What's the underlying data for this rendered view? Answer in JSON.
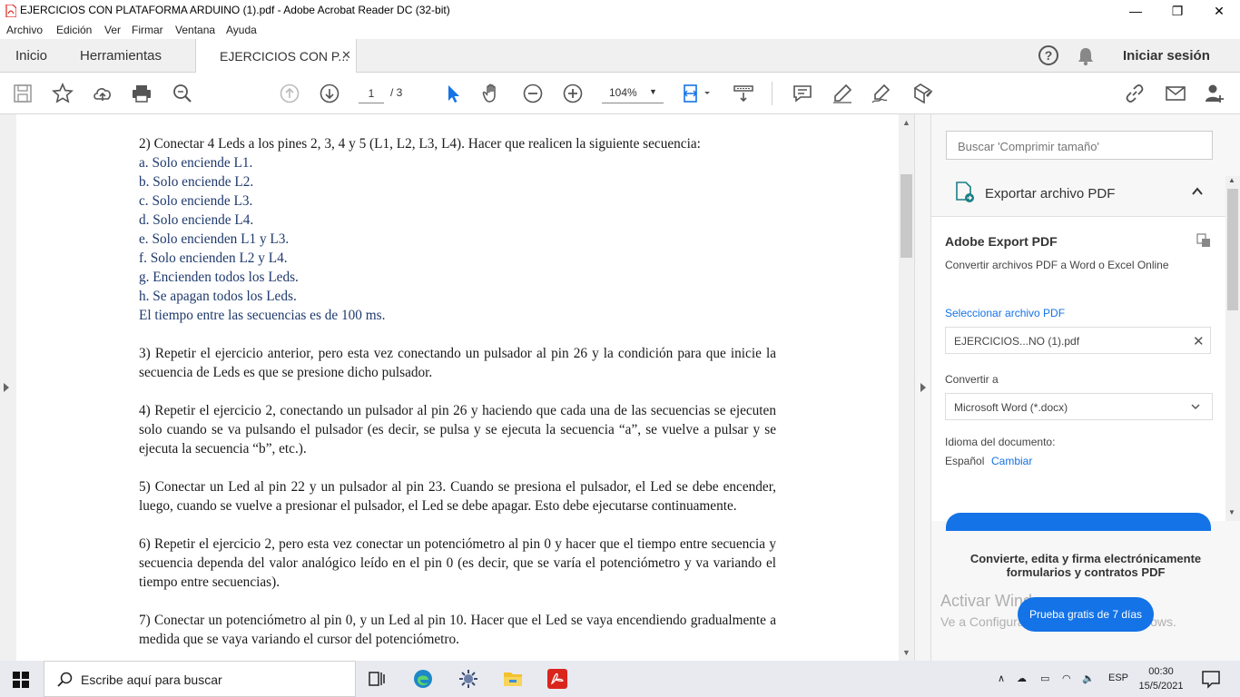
{
  "window": {
    "title": "EJERCICIOS CON PLATAFORMA ARDUINO (1).pdf - Adobe Acrobat Reader DC (32-bit)",
    "minimize": "—",
    "maximize": "❐",
    "close": "✕"
  },
  "menu": [
    "Archivo",
    "Edición",
    "Ver",
    "Firmar",
    "Ventana",
    "Ayuda"
  ],
  "tabs": {
    "home": "Inicio",
    "tools": "Herramientas",
    "document": "EJERCICIOS CON P...",
    "close": "✕"
  },
  "header": {
    "help": "?",
    "signin": "Iniciar sesión"
  },
  "toolbar": {
    "page_current": "1",
    "page_total": "/ 3",
    "zoom": "104%",
    "zoom_caret": "▼"
  },
  "document": {
    "ex2_title": "2) Conectar 4 Leds a los pines 2, 3, 4 y 5 (L1, L2, L3, L4). Hacer que realicen la siguiente secuencia:",
    "ex2_items": [
      "a. Solo enciende L1.",
      "b. Solo enciende L2.",
      "c. Solo enciende L3.",
      "d. Solo enciende L4.",
      "e. Solo encienden L1 y L3.",
      "f. Solo encienden L2 y L4.",
      "g. Encienden todos los Leds.",
      "h. Se apagan todos los Leds.",
      "El tiempo entre las secuencias es de 100 ms."
    ],
    "ex3": "3) Repetir el ejercicio anterior, pero esta vez conectando un pulsador al pin 26 y la condición para que inicie la secuencia de Leds es que se presione dicho pulsador.",
    "ex4": "4) Repetir el ejercicio 2, conectando un pulsador al pin 26 y haciendo que cada una de las secuencias se ejecuten solo cuando se va pulsando el pulsador (es decir, se pulsa y se ejecuta la secuencia “a”, se vuelve a pulsar y se ejecuta la secuencia “b”, etc.).",
    "ex5": "5) Conectar un Led al pin 22 y un pulsador al pin 23. Cuando se presiona el pulsador, el Led se debe encender, luego, cuando se vuelve a presionar el pulsador, el Led se debe apagar. Esto debe ejecutarse continuamente.",
    "ex6": "6) Repetir el ejercicio 2, pero esta vez conectar un potenciómetro al pin 0 y hacer que el tiempo entre secuencia y secuencia dependa del valor analógico leído en el pin 0 (es decir, que se varía el potenciómetro y va variando el tiempo entre secuencias).",
    "ex7": "7) Conectar un potenciómetro al pin 0, y un Led al pin 10. Hacer que el Led se vaya encendiendo gradualmente a medida que se vaya variando el cursor del potenciómetro."
  },
  "right_pane": {
    "search_placeholder": "Buscar 'Comprimir tamaño'",
    "export_title": "Exportar archivo PDF",
    "card_title": "Adobe Export PDF",
    "card_subtitle": "Convertir archivos PDF a Word o Excel Online",
    "select_file": "Seleccionar archivo PDF",
    "file_name": "EJERCICIOS...NO (1).pdf",
    "file_clear": "✕",
    "convert_to": "Convertir a",
    "format": "Microsoft Word (*.docx)",
    "language_label": "Idioma del documento:",
    "language_value": "Español",
    "language_change": "Cambiar",
    "promo": "Convierte, edita y firma electrónicamente formularios y contratos PDF",
    "trial_button": "Prueba gratis de 7 días",
    "watermark_line1": "Activar Windows",
    "watermark_line2": "Ve a Configuración para activar Windows."
  },
  "taskbar": {
    "search": "Escribe aquí para buscar",
    "lang": "ESP",
    "time": "00:30",
    "date": "15/5/2021"
  },
  "colors": {
    "accent": "#1473e6",
    "doc_blue": "#1f3a6e",
    "acrobat_red": "#d9251c"
  }
}
